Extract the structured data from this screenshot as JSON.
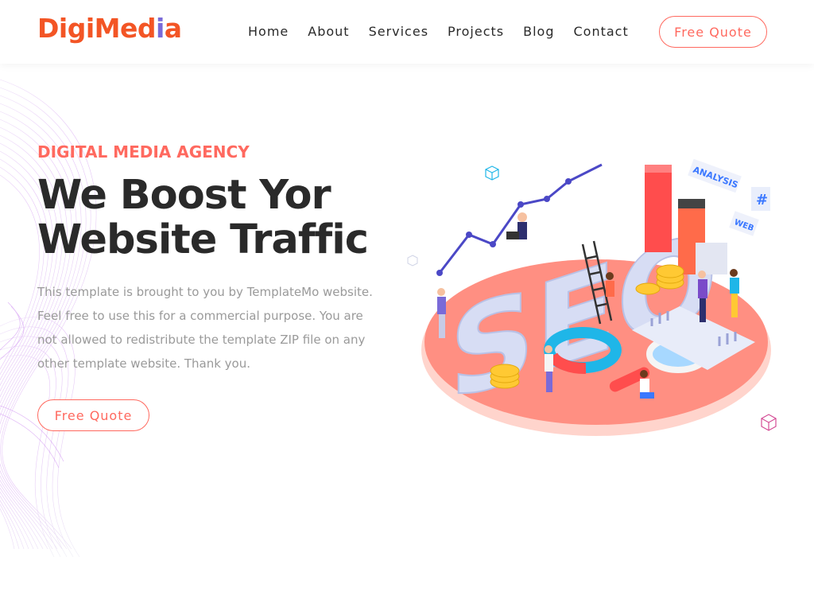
{
  "brand": {
    "logo_part1": "Digi",
    "logo_part2": "Med",
    "logo_part3": "i",
    "logo_part4": "a"
  },
  "nav": {
    "items": [
      "Home",
      "About",
      "Services",
      "Projects",
      "Blog",
      "Contact"
    ],
    "cta_label": "Free Quote"
  },
  "hero": {
    "tagline": "DIGITAL MEDIA AGENCY",
    "title_line1": "We Boost Yor",
    "title_line2": "Website Traffic",
    "description": "This template is brought to you by TemplateMo website. Feel free to use this for a commercial purpose. You are not allowed to redistribute the template ZIP file on any other template website. Thank you.",
    "cta_label": "Free Quote"
  },
  "illustration": {
    "big_text": "SEO",
    "labels": [
      "ANALYSIS",
      "#",
      "WEB"
    ]
  },
  "colors": {
    "accent": "#ff695f",
    "brand_orange": "#f35525",
    "brand_purple": "#7a6ad8",
    "heading": "#2a2a2a",
    "body_text": "#9a9a9a"
  }
}
